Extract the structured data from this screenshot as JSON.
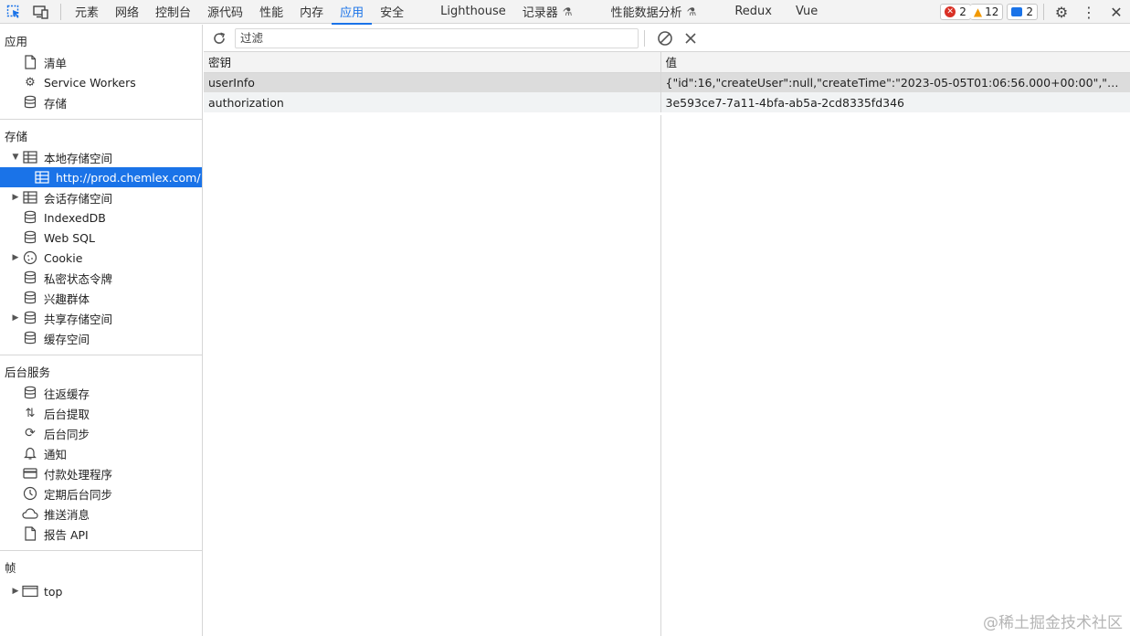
{
  "toolbar": {
    "tabs": [
      "元素",
      "网络",
      "控制台",
      "源代码",
      "性能",
      "内存",
      "应用",
      "安全",
      "Lighthouse",
      "记录器",
      "性能数据分析",
      "Redux",
      "Vue"
    ],
    "active_tab": "应用",
    "errors": "2",
    "warnings": "12",
    "messages": "2",
    "colors": {
      "accent": "#1a73e8",
      "error": "#d93025",
      "warning": "#f29900",
      "message": "#1a73e8"
    }
  },
  "sidebar": {
    "app_title": "应用",
    "app_items": [
      "清单",
      "Service Workers",
      "存储"
    ],
    "storage_title": "存储",
    "storage_items": [
      "本地存储空间",
      "http://prod.chemlex.com/",
      "会话存储空间",
      "IndexedDB",
      "Web SQL",
      "Cookie",
      "私密状态令牌",
      "兴趣群体",
      "共享存储空间",
      "缓存空间"
    ],
    "bg_title": "后台服务",
    "bg_items": [
      "往返缓存",
      "后台提取",
      "后台同步",
      "通知",
      "付款处理程序",
      "定期后台同步",
      "推送消息",
      "报告 API"
    ],
    "frames_title": "帧",
    "frames_items": [
      "top"
    ]
  },
  "main": {
    "filter_placeholder": "过滤",
    "columns": [
      "密钥",
      "值"
    ],
    "rows": [
      {
        "key": "userInfo",
        "value": "{\"id\":16,\"createUser\":null,\"createTime\":\"2023-05-05T01:06:56.000+00:00\",\"updateU..."
      },
      {
        "key": "authorization",
        "value": "3e593ce7-7a11-4bfa-ab5a-2cd8335fd346"
      }
    ]
  },
  "watermark": "@稀土掘金技术社区"
}
